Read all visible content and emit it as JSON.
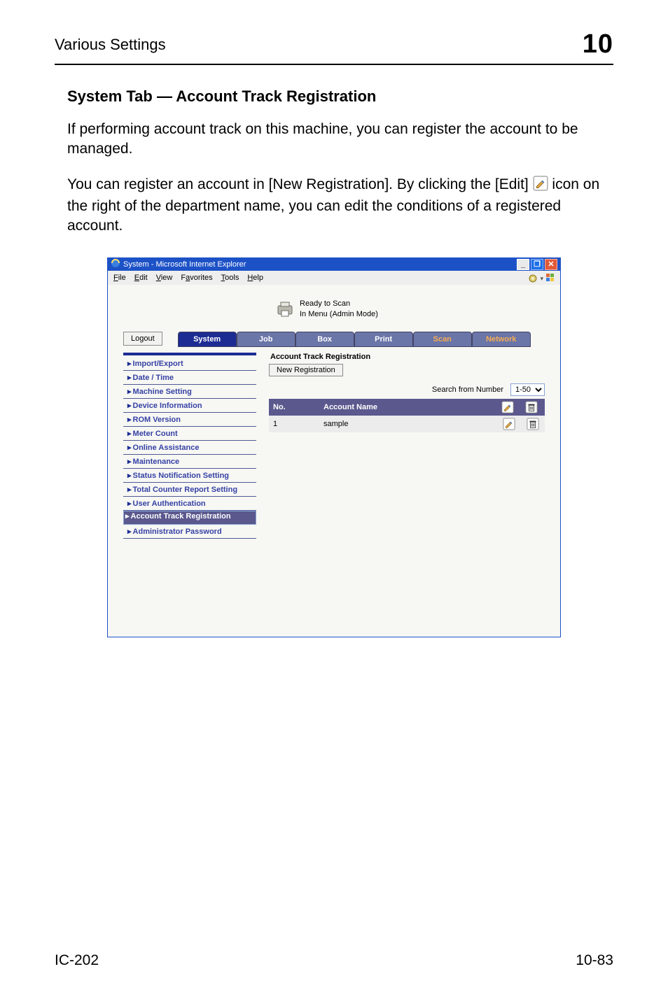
{
  "running_head": {
    "left": "Various Settings",
    "right": "10"
  },
  "section_title": "System Tab — Account Track Registration",
  "para1": "If performing account track on this machine, you can register the account to be managed.",
  "para2_a": "You can register an account in [New Registration]. By clicking the [Edit] ",
  "para2_b": " icon on the right of the department name, you can edit the conditions of a registered account.",
  "browser": {
    "title": "System - Microsoft Internet Explorer",
    "menu": {
      "file": "File",
      "edit": "Edit",
      "view": "View",
      "favorites": "Favorites",
      "tools": "Tools",
      "help": "Help"
    },
    "banner": {
      "line1": "Ready to Scan",
      "line2": "In Menu (Admin Mode)"
    },
    "logout": "Logout",
    "tabs": {
      "system": "System",
      "job": "Job",
      "box": "Box",
      "print": "Print",
      "scan": "Scan",
      "network": "Network"
    },
    "side": [
      "Import/Export",
      "Date / Time",
      "Machine Setting",
      "Device Information",
      "ROM Version",
      "Meter Count",
      "Online Assistance",
      "Maintenance",
      "Status Notification Setting",
      "Total Counter Report Setting",
      "User Authentication",
      "Account Track Registration",
      "Administrator Password"
    ],
    "side_selected_index": 11,
    "main": {
      "title": "Account Track Registration",
      "new_reg": "New Registration",
      "search_label": "Search from Number",
      "search_value": "1-50",
      "col_no": "No.",
      "col_name": "Account Name",
      "row_no": "1",
      "row_name": "sample"
    }
  },
  "footer": {
    "left": "IC-202",
    "right": "10-83"
  }
}
